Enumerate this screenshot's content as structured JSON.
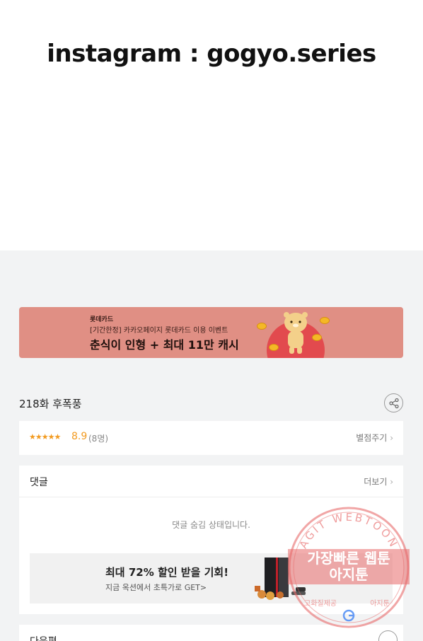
{
  "top_image": {
    "handle_text": "instagram : gogyo.series"
  },
  "banner": {
    "brand": "롯데카드",
    "subtitle": "[기간한정] 카카오페이지 롯데카드 이용 이벤트",
    "headline": "춘식이 인형 + 최대 11만 캐시"
  },
  "episode": {
    "title": "218화 후폭풍",
    "share_icon": "share-icon"
  },
  "rating": {
    "stars_text": "★★★★★",
    "score": "8.9",
    "count": "(8명)",
    "rate_label": "별점주기",
    "chevron": "›",
    "color": "#f29a1f"
  },
  "comments": {
    "title": "댓글",
    "more_label": "더보기",
    "chevron": "›",
    "hidden_message": "댓글 숨김 상태입니다."
  },
  "ad": {
    "headline": "최대 72% 할인 받을 기회!",
    "subline": "지금 옥션에서 초특가로 GET>"
  },
  "next": {
    "title": "다음편"
  },
  "watermark": {
    "arc_text": "AGIT WEBTOON",
    "line1": "가장빠른 웹툰",
    "line2": "아지툰",
    "bottom_left": "고화질제공",
    "bottom_right": "아지툰",
    "color": "#e04a4a"
  }
}
